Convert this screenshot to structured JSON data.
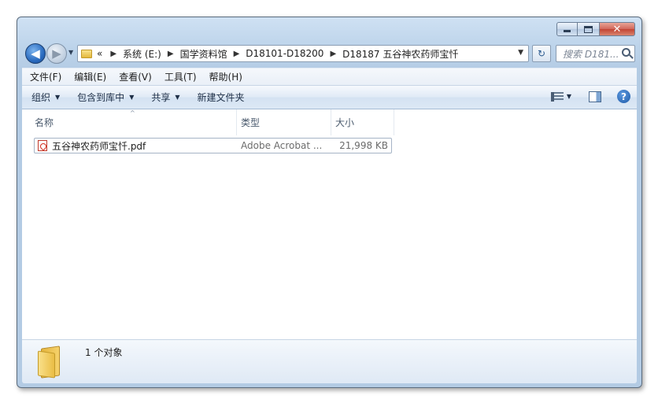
{
  "window": {
    "caption": {
      "minimize": "",
      "maximize": "",
      "close": "✕"
    }
  },
  "nav": {
    "back_glyph": "◀",
    "forward_glyph": "▶",
    "history_glyph": "▼",
    "address_prefix": "«",
    "breadcrumbs": [
      "系统 (E:)",
      "国学资料馆",
      "D18101-D18200",
      "D18187 五谷神农药师宝忏"
    ],
    "address_dropdown_glyph": "▼",
    "refresh_glyph": "↻",
    "search_placeholder": "搜索 D181..."
  },
  "menubar": {
    "items": [
      "文件(F)",
      "编辑(E)",
      "查看(V)",
      "工具(T)",
      "帮助(H)"
    ]
  },
  "cmdbar": {
    "organize": "组织",
    "include_library": "包含到库中",
    "share": "共享",
    "new_folder": "新建文件夹",
    "dropdown_glyph": "▼",
    "help_glyph": "?"
  },
  "columns": {
    "name": "名称",
    "type": "类型",
    "size": "大小",
    "sort_glyph": "^"
  },
  "files": [
    {
      "name": "五谷神农药师宝忏.pdf",
      "type": "Adobe Acrobat ...",
      "size": "21,998 KB",
      "icon": "pdf-icon"
    }
  ],
  "details": {
    "status": "1 个对象",
    "icon": "folder-icon"
  }
}
